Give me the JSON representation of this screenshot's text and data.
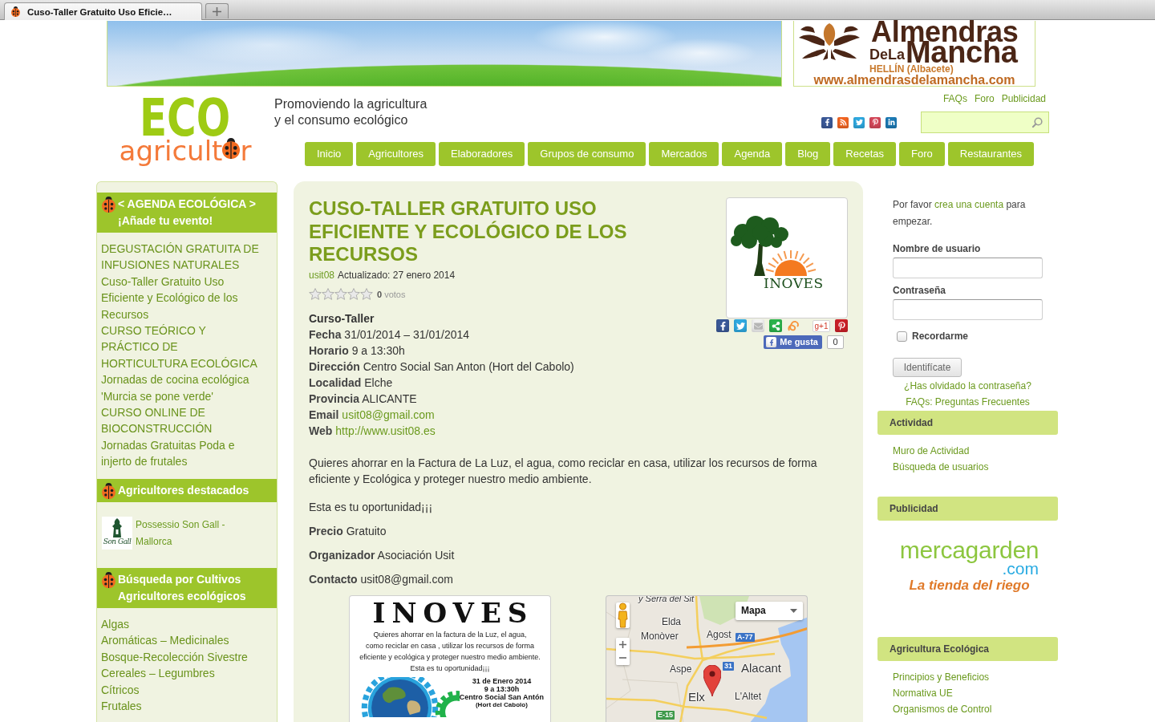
{
  "browser": {
    "tab_title": "Cuso-Taller Gratuito Uso Eficie…"
  },
  "header": {
    "ad": {
      "brand_top": "Almendras",
      "brand_small": "DeLa",
      "brand_bottom": "Mancha",
      "location": "HELLÍN (Albacete)",
      "url": "www.almendrasdelamancha.com"
    },
    "logo": {
      "top": "ECO",
      "bottom_start": "agricult",
      "bottom_end": "r"
    },
    "tagline": [
      "Promoviendo la agricultura",
      "y el consumo ecológico"
    ],
    "top_links": [
      "FAQs",
      "Foro",
      "Publicidad"
    ],
    "nav": [
      "Inicio",
      "Agricultores",
      "Elaboradores",
      "Grupos de consumo",
      "Mercados",
      "Agenda",
      "Blog",
      "Recetas",
      "Foro",
      "Restaurantes"
    ]
  },
  "left_sidebar": [
    {
      "kind": "links",
      "title": [
        "< AGENDA ECOLÓGICA >",
        "¡Añade tu evento!"
      ],
      "links": [
        "DEGUSTACIÓN GRATUITA DE INFUSIONES NATURALES",
        "Cuso-Taller Gratuito Uso Eficiente y Ecológico de los Recursos",
        "CURSO TEÓRICO Y PRÁCTICO DE HORTICULTURA ECOLÓGICA",
        "Jornadas de cocina ecológica 'Murcia se pone verde'",
        "CURSO ONLINE DE BIOCONSTRUCCIÓN",
        "Jornadas Gratuitas Poda e injerto de frutales"
      ]
    },
    {
      "kind": "featured",
      "title": [
        "Agricultores destacados"
      ],
      "items": [
        {
          "logo_text": "Son Gall",
          "name": "Possessio Son Gall - Mallorca"
        }
      ]
    },
    {
      "kind": "links",
      "title": [
        "Búsqueda por Cultivos",
        "Agricultores ecológicos"
      ],
      "links": [
        "Algas",
        "Aromáticas – Medicinales",
        "Bosque-Recolección Sivestre",
        "Cereales – Legumbres",
        "Cítricos",
        "Frutales"
      ]
    }
  ],
  "article": {
    "title": "CUSO-TALLER GRATUITO USO EFICIENTE Y ECOLÓGICO DE LOS RECURSOS",
    "author": "usit08",
    "updated": "Actualizado: 27 enero 2014",
    "rating": {
      "stars": 0,
      "votes": "**0** votos"
    },
    "image": {
      "logo_text": "INOVES"
    },
    "share": {
      "plus_label": "g+1",
      "like_label": "Me gusta",
      "like_count": "0"
    },
    "details": [
      {
        "kind": "heading",
        "text": "Curso-Taller"
      },
      {
        "kind": "text",
        "text": "**Fecha** 31/01/2014 – 31/01/2014"
      },
      {
        "kind": "text",
        "text": "**Horario** 9 a 13:30h"
      },
      {
        "kind": "text",
        "text": "**Dirección** Centro Social San Anton (Hort del Cabolo)"
      },
      {
        "kind": "text",
        "text": "**Localidad** Elche"
      },
      {
        "kind": "text",
        "text": "**Provincia** ALICANTE"
      },
      {
        "kind": "link",
        "label": "Email",
        "link": "usit08@gmail.com"
      },
      {
        "kind": "link",
        "label": "Web",
        "link": "http://www.usit08.es"
      }
    ],
    "body": [
      "Quieres ahorrar en la Factura de La Luz, el agua, como reciclar en casa, utilizar los recursos de forma eficiente y Ecológica y proteger nuestro medio ambiente.",
      "Esta es tu oportunidad¡¡¡",
      "**Precio** Gratuito",
      "**Organizador** Asociación Usit",
      "**Contacto** usit08@gmail.com"
    ],
    "poster": {
      "title": "INOVES",
      "text_lines": [
        "Quieres ahorrar en la factura de la Luz, el agua,",
        "como reciclar en casa , utilizar los recursos de forma",
        "eficiente y ecológica y proteger nuestro medio ambiente.",
        "Esta es tu oportunidad¡¡¡"
      ],
      "event_lines": [
        "31 de Enero 2014",
        "9 a 13:30h",
        "Centro Social San Antón",
        "(Hort del Cabolo)"
      ]
    },
    "map": {
      "type_control": "Mapa",
      "labels": [
        {
          "kind": "area",
          "text": "y Serra del Sit"
        },
        {
          "kind": "town",
          "text": "Elda"
        },
        {
          "kind": "town",
          "text": "Monòver"
        },
        {
          "kind": "town",
          "text": "Agost"
        },
        {
          "kind": "motorway",
          "text": "A-77"
        },
        {
          "kind": "town",
          "text": "Aspe"
        },
        {
          "kind": "motorway",
          "text": "31"
        },
        {
          "kind": "city",
          "text": "Alacant"
        },
        {
          "kind": "city",
          "text": "Elx"
        },
        {
          "kind": "town",
          "text": "L'Altet"
        },
        {
          "kind": "european_route",
          "text": "E-15"
        }
      ]
    }
  },
  "right_sidebar": {
    "login": {
      "prompt_before": "Por favor",
      "prompt_link": "crea una cuenta",
      "prompt_after": "para empezar.",
      "username_label": "Nombre de usuario",
      "password_label": "Contraseña",
      "remember": {
        "label": "Recordarme",
        "checked": false
      },
      "submit": "Identifícate",
      "links": [
        "¿Has olvidado la contraseña?",
        "FAQs: Preguntas Frecuentes"
      ]
    },
    "widgets": [
      {
        "kind": "links",
        "title": "Actividad",
        "links": [
          "Muro de Actividad",
          "Búsqueda de usuarios"
        ]
      },
      {
        "kind": "ad",
        "title": "Publicidad",
        "ad": {
          "brand": "mercagarden",
          "domain": ".com",
          "slogan": "La tienda del riego"
        }
      },
      {
        "kind": "links",
        "title": "Agricultura Ecológica",
        "links": [
          "Principios y Beneficios",
          "Normativa UE",
          "Organismos de Control"
        ]
      }
    ]
  }
}
